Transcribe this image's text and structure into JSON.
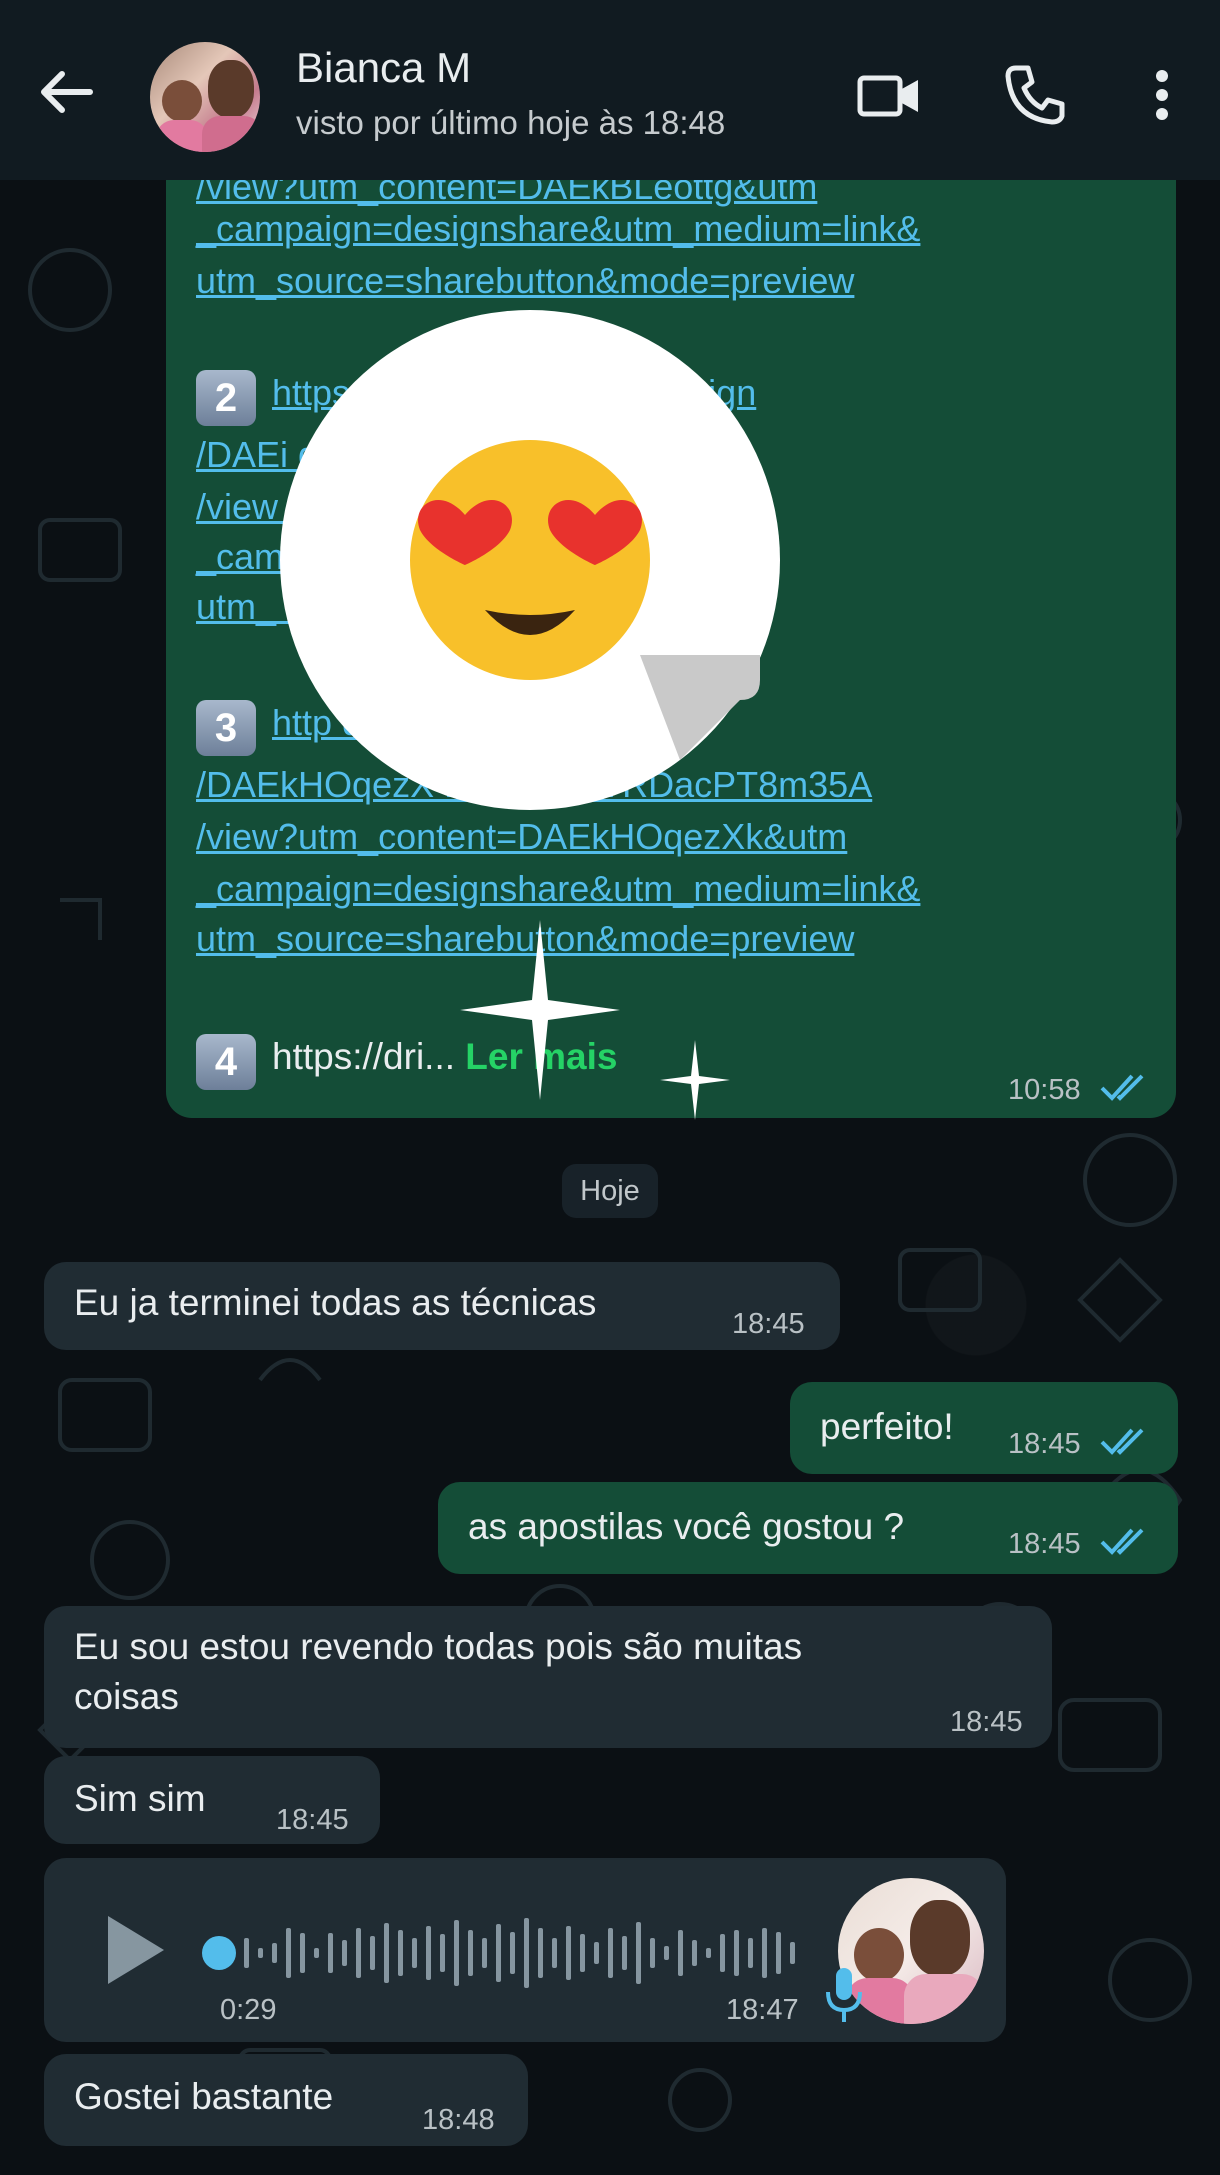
{
  "header": {
    "contact_name": "Bianca M",
    "last_seen": "visto por último hoje às 18:48",
    "icons": [
      "back-arrow-icon",
      "video-call-icon",
      "voice-call-icon",
      "more-options-icon"
    ]
  },
  "top_message": {
    "links": [
      "/view?utm_content=DAEkBLeottg&utm",
      "_campaign=designshare&utm_medium=link&",
      "utm_source=sharebutton&mode=preview"
    ],
    "item2_number": "2",
    "item2_lines": [
      "https://www.canva.com/design",
      "/DAEi                             douwp4vvVhmaQ",
      "/view                                   NfaY&utm",
      "_cam                                 _medium=link&",
      "utm_                                 de=preview"
    ],
    "item3_number": "3",
    "item3_lines": [
      "http                                    design",
      "/DAEkHOqezX                D5nDD6xTRDacPT8m35A",
      "/view?utm_content=DAEkHOqezXk&utm",
      "_campaign=designshare&utm_medium=link&",
      "utm_source=sharebutton&mode=preview"
    ],
    "item4_number": "4",
    "item4_text": "https://dri...",
    "read_more": "Ler mais",
    "time": "10:58"
  },
  "sticker": {
    "emoji": "😍"
  },
  "date_chip": "Hoje",
  "messages": [
    {
      "direction": "in",
      "text": "Eu ja terminei todas as técnicas",
      "time": "18:45"
    },
    {
      "direction": "out",
      "text": "perfeito!",
      "time": "18:45"
    },
    {
      "direction": "out",
      "text": "as apostilas você gostou ?",
      "time": "18:45"
    },
    {
      "direction": "in",
      "text_line1": "Eu sou estou revendo todas pois são muitas",
      "text_line2": "coisas",
      "time": "18:45"
    },
    {
      "direction": "in",
      "text": "Sim sim",
      "time": "18:45"
    },
    {
      "direction": "in",
      "type": "voice",
      "duration": "0:29",
      "time": "18:47"
    },
    {
      "direction": "in",
      "text": "Gostei bastante",
      "time": "18:48"
    }
  ],
  "colors": {
    "header_bg": "#111b21",
    "chat_bg": "#0b1014",
    "outgoing_bubble": "#144d37",
    "incoming_bubble": "#202c33",
    "link": "#53bdeb",
    "read_ticks": "#53bdeb",
    "accent_green": "#25d366"
  }
}
